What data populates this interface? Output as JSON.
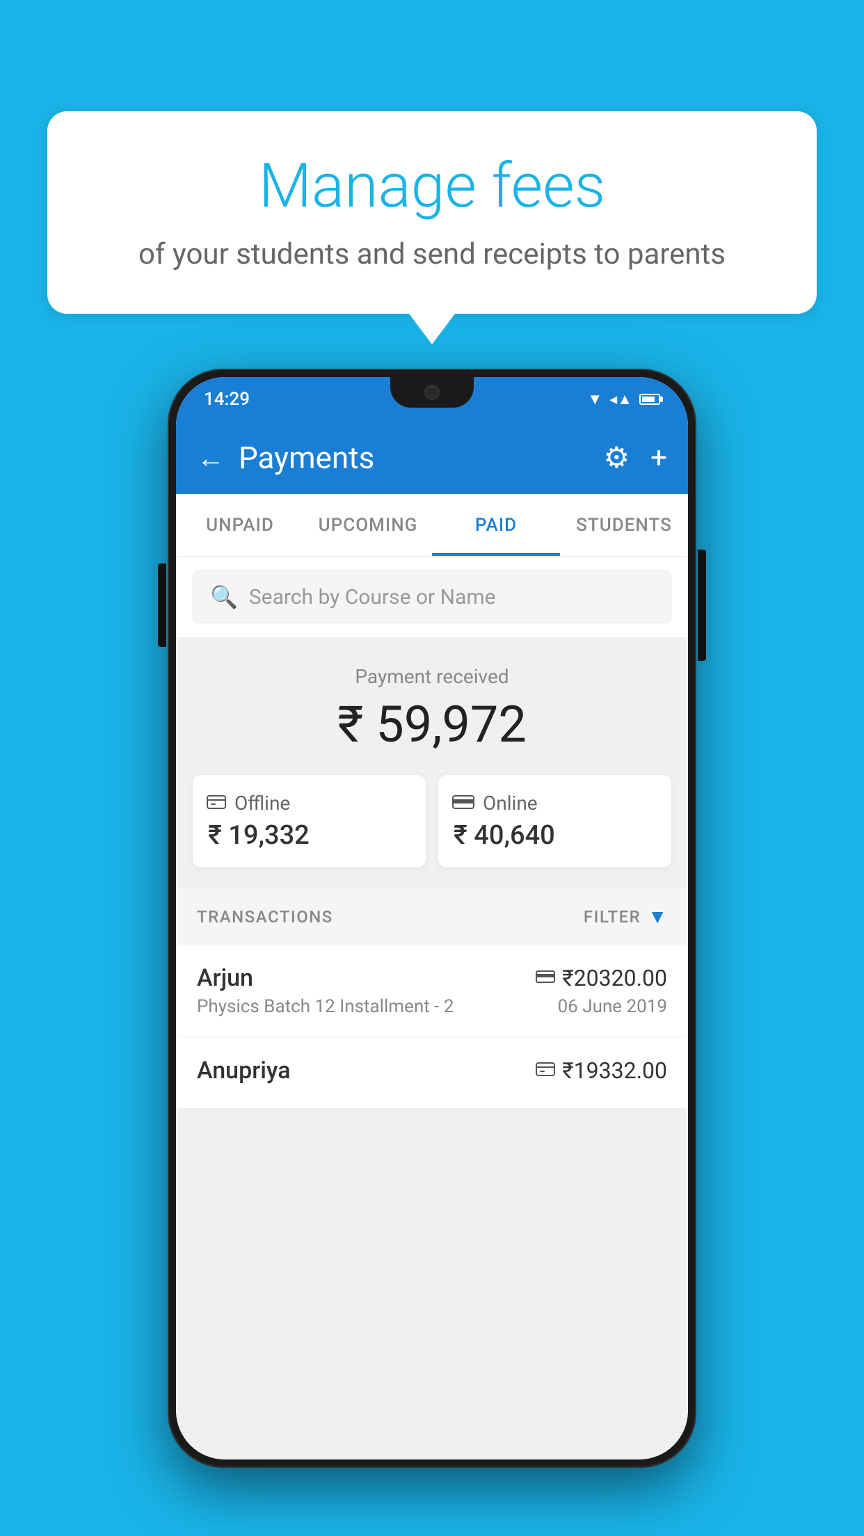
{
  "page": {
    "background_color": "#1ab3e8"
  },
  "bubble": {
    "title": "Manage fees",
    "subtitle": "of your students and send receipts to parents"
  },
  "status_bar": {
    "time": "14:29"
  },
  "app_bar": {
    "title": "Payments",
    "back_label": "←",
    "settings_label": "⚙",
    "add_label": "+"
  },
  "tabs": [
    {
      "label": "UNPAID",
      "active": false
    },
    {
      "label": "UPCOMING",
      "active": false
    },
    {
      "label": "PAID",
      "active": true
    },
    {
      "label": "STUDENTS",
      "active": false
    }
  ],
  "search": {
    "placeholder": "Search by Course or Name"
  },
  "summary": {
    "label": "Payment received",
    "amount": "₹ 59,972",
    "cards": [
      {
        "icon": "₹",
        "label": "Offline",
        "amount": "₹ 19,332"
      },
      {
        "icon": "▬",
        "label": "Online",
        "amount": "₹ 40,640"
      }
    ]
  },
  "transactions": {
    "header": "TRANSACTIONS",
    "filter_label": "FILTER",
    "items": [
      {
        "name": "Arjun",
        "amount": "₹20320.00",
        "type_icon": "▬",
        "course": "Physics Batch 12 Installment - 2",
        "date": "06 June 2019"
      },
      {
        "name": "Anupriya",
        "amount": "₹19332.00",
        "type_icon": "₹",
        "course": "",
        "date": ""
      }
    ]
  }
}
